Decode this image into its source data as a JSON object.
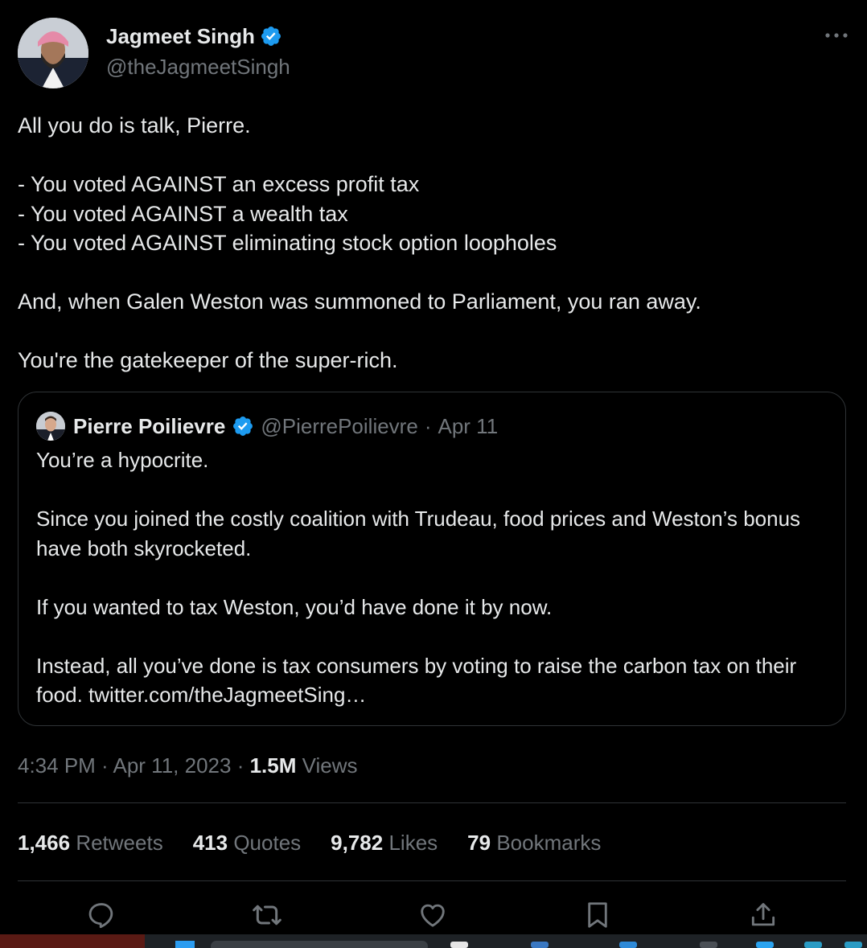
{
  "author": {
    "display_name": "Jagmeet Singh",
    "handle": "@theJagmeetSingh",
    "verified": true
  },
  "tweet": {
    "lines": [
      "All you do is talk, Pierre.",
      "",
      "- You voted AGAINST an excess profit tax",
      "- You voted AGAINST a wealth tax",
      "- You voted AGAINST eliminating stock option loopholes",
      "",
      "And, when Galen Weston was summoned to Parliament, you ran away.",
      "",
      "You're the gatekeeper of the super-rich."
    ]
  },
  "quote": {
    "display_name": "Pierre Poilievre",
    "handle": "@PierrePoilievre",
    "separator": "·",
    "date": "Apr 11",
    "verified": true,
    "lines": [
      "You’re a hypocrite.",
      "",
      "Since you joined the costly coalition with Trudeau, food prices and Weston’s bonus have both skyrocketed.",
      "",
      "If you wanted to tax Weston, you’d have done it by now.",
      "",
      "Instead, all you’ve done is tax consumers by voting to raise the carbon tax on their food. twitter.com/theJagmeetSing…"
    ]
  },
  "meta": {
    "time": "4:34 PM",
    "sep1": " · ",
    "date": "Apr 11, 2023",
    "sep2": " · ",
    "views_count": "1.5M",
    "views_label": " Views"
  },
  "stats": [
    {
      "count": "1,466",
      "label": "Retweets"
    },
    {
      "count": "413",
      "label": "Quotes"
    },
    {
      "count": "9,782",
      "label": "Likes"
    },
    {
      "count": "79",
      "label": "Bookmarks"
    }
  ],
  "actions": [
    {
      "icon": "reply-icon"
    },
    {
      "icon": "retweet-icon"
    },
    {
      "icon": "like-icon"
    },
    {
      "icon": "bookmark-icon"
    },
    {
      "icon": "share-icon"
    }
  ],
  "colors": {
    "background": "#000000",
    "text_primary": "#e7e9ea",
    "text_secondary": "#71767b",
    "border": "#2f3336",
    "verified_blue": "#1d9bf0"
  }
}
